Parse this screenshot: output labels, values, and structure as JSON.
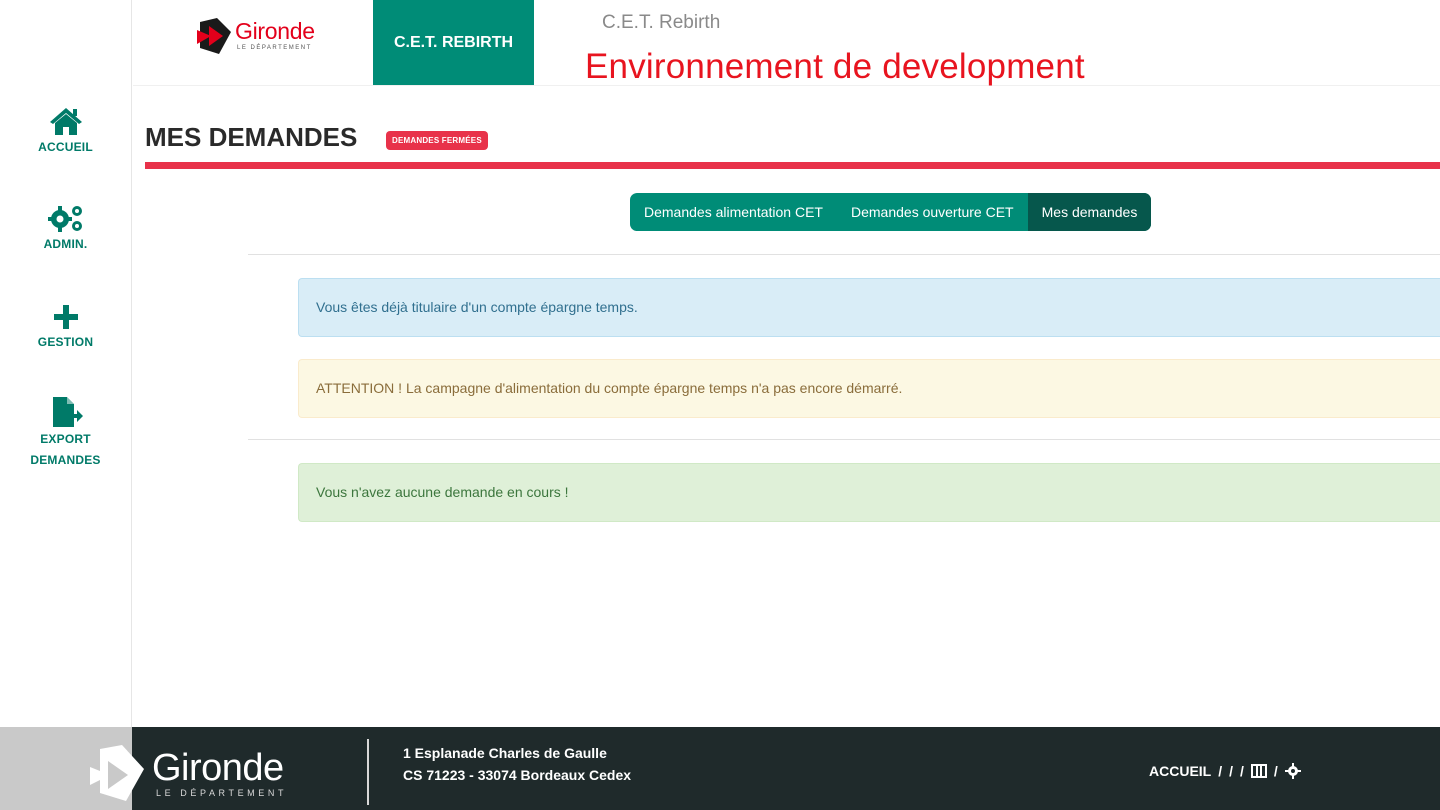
{
  "header": {
    "logo_word": "Gironde",
    "logo_sub": "LE DÉPARTEMENT",
    "app_tab_label": "C.E.T. REBIRTH",
    "app_name": "C.E.T. Rebirth",
    "environment": "Environnement de development"
  },
  "sidebar": {
    "items": [
      {
        "label": "ACCUEIL",
        "icon": "home-icon"
      },
      {
        "label": "ADMIN.",
        "icon": "gears-icon"
      },
      {
        "label": "GESTION",
        "icon": "plus-icon"
      },
      {
        "label": "EXPORT",
        "label2": "DEMANDES",
        "icon": "file-export-icon"
      }
    ]
  },
  "page": {
    "title": "MES DEMANDES",
    "badge": "DEMANDES FERMÉES"
  },
  "tabs": [
    {
      "label": "Demandes alimentation CET",
      "active": false
    },
    {
      "label": "Demandes ouverture CET",
      "active": false
    },
    {
      "label": "Mes demandes",
      "active": true
    }
  ],
  "alerts": {
    "info": "Vous êtes déjà  titulaire d'un compte épargne temps.",
    "warning": "ATTENTION ! La campagne d'alimentation du compte épargne temps n'a pas encore démarré.",
    "success": "Vous n'avez aucune demande en cours !"
  },
  "footer": {
    "logo_word": "Gironde",
    "logo_sub": "LE DÉPARTEMENT",
    "address_line1": "1 Esplanade Charles de Gaulle",
    "address_line2": "CS 71223 - 33074 Bordeaux Cedex",
    "nav_home": "ACCUEIL",
    "nav_sep": "/"
  },
  "colors": {
    "primary": "#008c77",
    "primary_dark": "#06574c",
    "accent_red": "#e8324a",
    "env_red": "#e8141f",
    "footer_bg": "#1f2a2b"
  }
}
